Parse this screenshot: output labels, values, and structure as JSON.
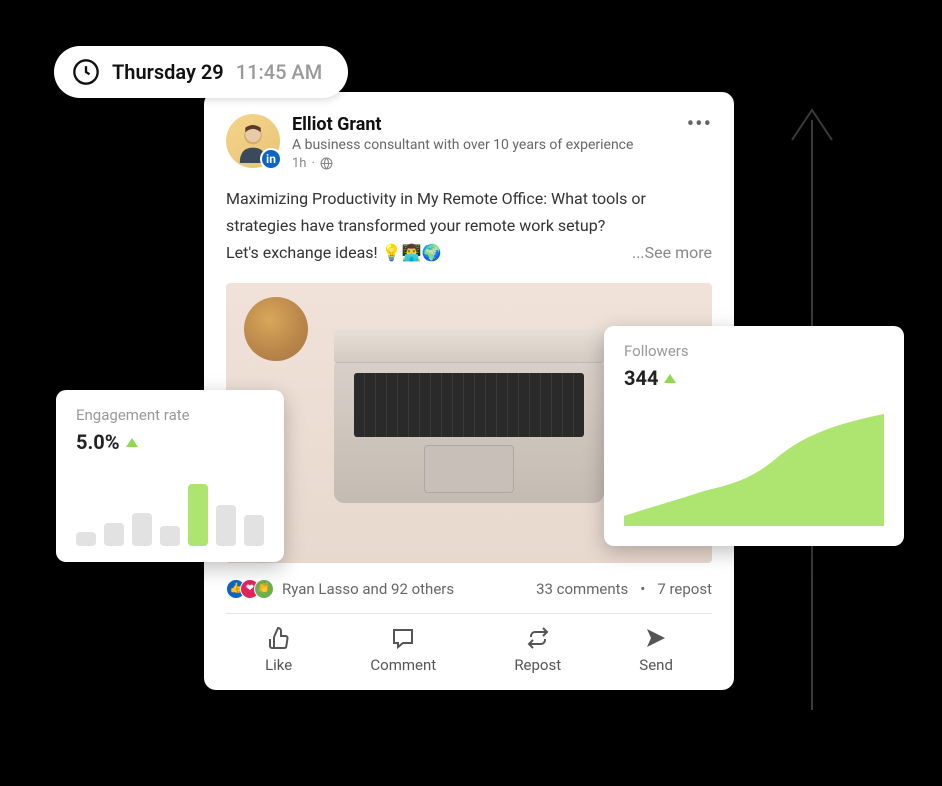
{
  "timestamp": {
    "day": "Thursday 29",
    "time": "11:45 AM"
  },
  "post": {
    "author": "Elliot Grant",
    "subtitle": "A business consultant with over 10 years of experience",
    "age": "1h",
    "body_line1": "Maximizing Productivity in My Remote Office: What tools or strategies have transformed your remote work setup?",
    "body_line2": "Let's exchange ideas! 💡👨‍💻🌍",
    "see_more": "...See more",
    "likes_text": "Ryan Lasso and 92 others",
    "comments_text": "33 comments",
    "repost_text": "7 repost"
  },
  "actions": {
    "like": "Like",
    "comment": "Comment",
    "repost": "Repost",
    "send": "Send"
  },
  "widgets": {
    "engagement": {
      "label": "Engagement rate",
      "value": "5.0%"
    },
    "followers": {
      "label": "Followers",
      "value": "344"
    }
  },
  "chart_data": [
    {
      "type": "bar",
      "title": "Engagement rate",
      "value_label": "5.0%",
      "categories": [
        "",
        "",
        "",
        "",
        "",
        "",
        ""
      ],
      "values": [
        18,
        30,
        42,
        26,
        80,
        52,
        40
      ],
      "highlight_index": 4,
      "ylim": [
        0,
        100
      ]
    },
    {
      "type": "area",
      "title": "Followers",
      "value_label": "344",
      "x": [
        0,
        1,
        2,
        3,
        4,
        5,
        6,
        7
      ],
      "values": [
        8,
        18,
        28,
        34,
        42,
        66,
        88,
        98
      ],
      "ylim": [
        0,
        100
      ]
    }
  ]
}
